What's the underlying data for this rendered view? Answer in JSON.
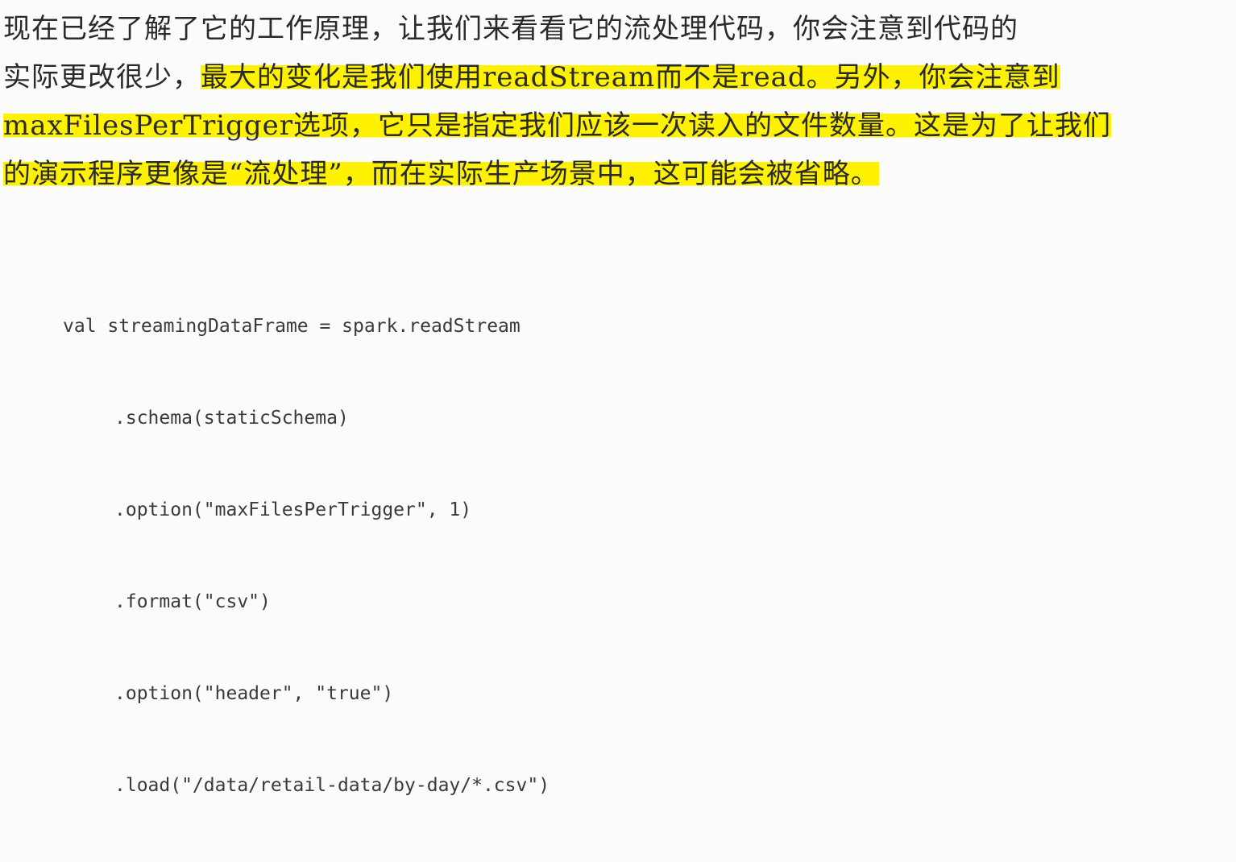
{
  "prose": {
    "line1": "现在已经了解了它的工作原理，让我们来看看它的流处理代码，你会注意到代码的",
    "line2_plain": "实际更改很少，",
    "line2_highlight": "最大的变化是我们使用readStream而不是read。另外，你会注意到",
    "line3_highlight": "maxFilesPerTrigger选项，它只是指定我们应该一次读入的文件数量。这是为了让我们",
    "line4_highlight": "的演示程序更像是“流处理”，而在实际生产场景中，这可能会被省略。"
  },
  "code": {
    "lines": [
      "val streamingDataFrame = spark.readStream",
      ".schema(staticSchema)",
      ".option(\"maxFilesPerTrigger\", 1)",
      ".format(\"csv\")",
      ".option(\"header\", \"true\")",
      ".load(\"/data/retail-data/by-day/*.csv\")"
    ]
  },
  "colors": {
    "highlight": "#fff200",
    "text": "#2a2a2a",
    "background": "#fbfbf9"
  }
}
